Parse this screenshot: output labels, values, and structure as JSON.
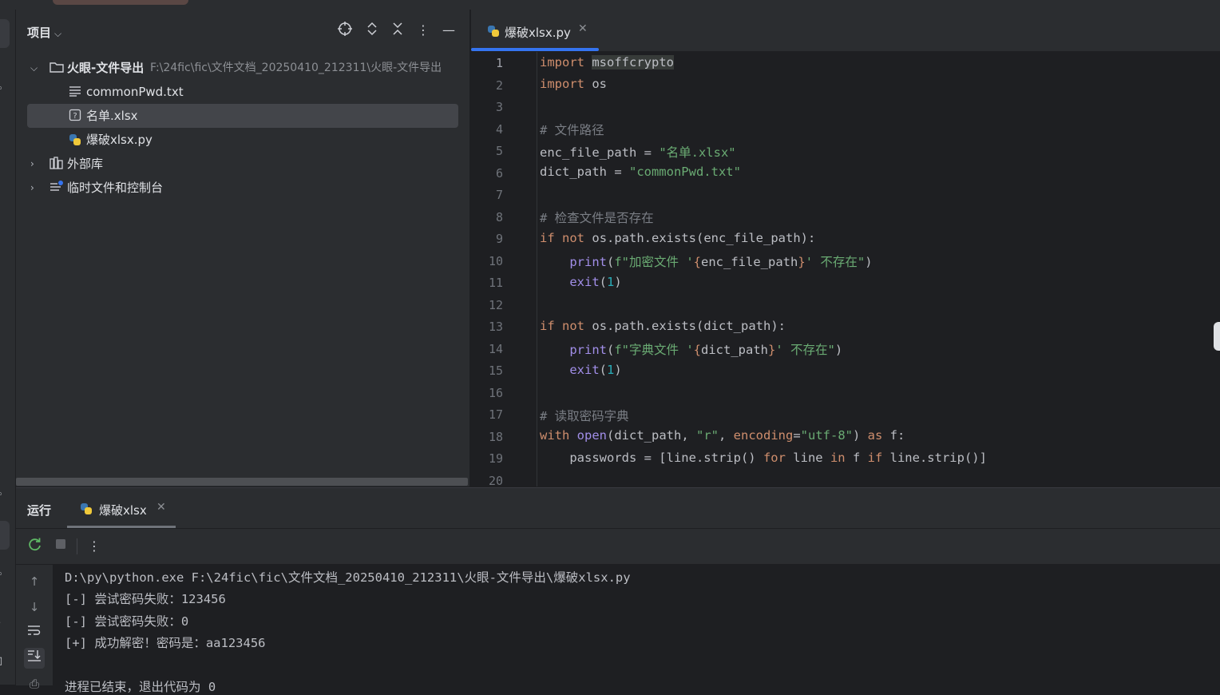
{
  "project_panel": {
    "title": "项目",
    "tree": [
      {
        "label": "火眼-文件导出",
        "path": "F:\\24fic\\fic\\文件文档_20250410_212311\\火眼-文件导出",
        "expanded": true,
        "icon": "folder-icon"
      },
      {
        "label": "commonPwd.txt",
        "icon": "text-file-icon"
      },
      {
        "label": "名单.xlsx",
        "icon": "unknown-file-icon",
        "selected": true
      },
      {
        "label": "爆破xlsx.py",
        "icon": "python-file-icon"
      },
      {
        "label": "外部库",
        "icon": "library-icon"
      },
      {
        "label": "临时文件和控制台",
        "icon": "scratches-icon"
      }
    ]
  },
  "editor": {
    "tab_label": "爆破xlsx.py",
    "current_line": 1,
    "line_numbers": [
      "1",
      "2",
      "3",
      "4",
      "5",
      "6",
      "7",
      "8",
      "9",
      "10",
      "11",
      "12",
      "13",
      "14",
      "15",
      "16",
      "17",
      "18",
      "19",
      "20"
    ],
    "code": {
      "l1_kw": "import",
      "l1_rest": "msoffcrypto",
      "l2_kw": "import",
      "l2_rest": "os",
      "l4": "# 文件路径",
      "l5_a": "enc_file_path = ",
      "l5_s": "\"名单.xlsx\"",
      "l6_a": "dict_path = ",
      "l6_s": "\"commonPwd.txt\"",
      "l8": "# 检查文件是否存在",
      "l9_kw1": "if",
      "l9_kw2": "not",
      "l9_rest": "os.path.exists(enc_file_path):",
      "l10_fn": "print",
      "l10_p": "(",
      "l10_s1": "f\"加密文件 '",
      "l10_b1": "{",
      "l10_v": "enc_file_path",
      "l10_b2": "}",
      "l10_s2": "' 不存在\"",
      "l10_e": ")",
      "l11_fn": "exit",
      "l11_p": "(",
      "l11_n": "1",
      "l11_e": ")",
      "l13_kw1": "if",
      "l13_kw2": "not",
      "l13_rest": "os.path.exists(dict_path):",
      "l14_fn": "print",
      "l14_p": "(",
      "l14_s1": "f\"字典文件 '",
      "l14_b1": "{",
      "l14_v": "dict_path",
      "l14_b2": "}",
      "l14_s2": "' 不存在\"",
      "l14_e": ")",
      "l15_fn": "exit",
      "l15_p": "(",
      "l15_n": "1",
      "l15_e": ")",
      "l17": "# 读取密码字典",
      "l18_kw": "with",
      "l18_fn": "open",
      "l18_a": "(dict_path, ",
      "l18_s1": "\"r\"",
      "l18_c": ", ",
      "l18_param": "encoding",
      "l18_eq": "=",
      "l18_s2": "\"utf-8\"",
      "l18_e": ") ",
      "l18_kw2": "as",
      "l18_f": " f:",
      "l19_a": "passwords = [line.strip() ",
      "l19_kw1": "for",
      "l19_b": " line ",
      "l19_kw2": "in",
      "l19_c": " f ",
      "l19_kw3": "if",
      "l19_d": " line.strip()]"
    }
  },
  "run_panel": {
    "label": "运行",
    "tab_label": "爆破xlsx",
    "console_lines": [
      "D:\\py\\python.exe F:\\24fic\\fic\\文件文档_20250410_212311\\火眼-文件导出\\爆破xlsx.py",
      "[-] 尝试密码失败：123456",
      "[-] 尝试密码失败：0",
      "[+] 成功解密！密码是：aa123456",
      "",
      "进程已结束，退出代码为 0"
    ]
  },
  "colors": {
    "accent": "#3574f0",
    "keyword": "#cf8e6d",
    "string": "#6aab73",
    "comment": "#7a7e85",
    "function": "#a18ee8",
    "number": "#2aacb8"
  }
}
